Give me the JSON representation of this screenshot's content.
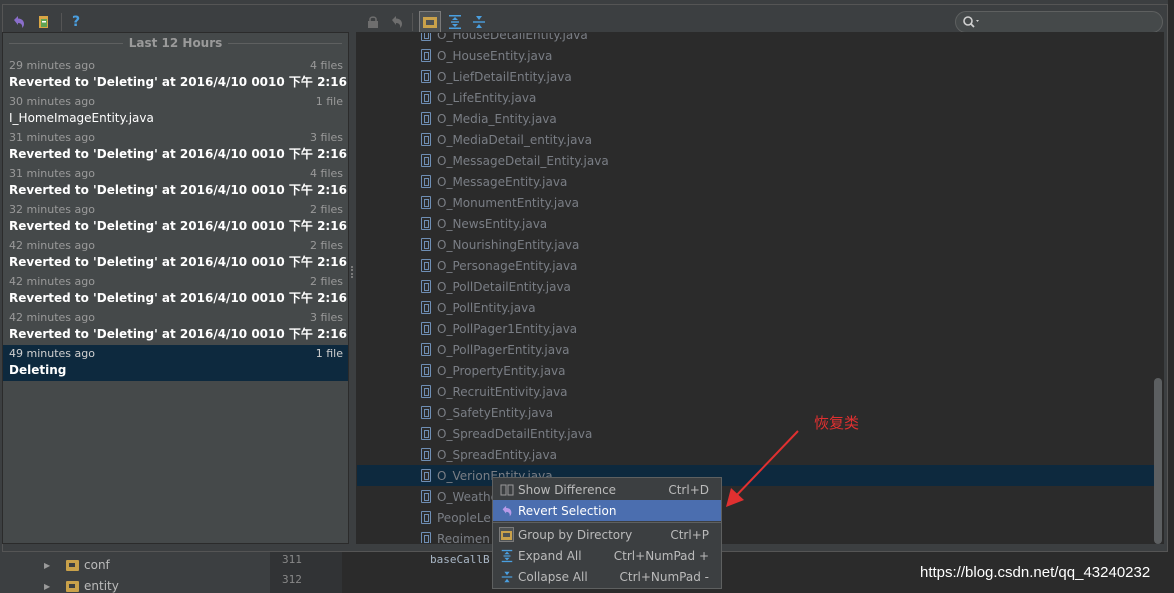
{
  "background": {
    "tree_items": [
      {
        "label": "conf"
      },
      {
        "label": "entity"
      }
    ],
    "line_numbers": [
      "311",
      "312"
    ],
    "code_line": "baseCallB                          ntity) netTask.getResult();",
    "watermark": "https://blog.csdn.net/qq_43240232"
  },
  "toolbar": {
    "search_placeholder": ""
  },
  "history": {
    "group_header": "Last 12 Hours",
    "items": [
      {
        "time": "29 minutes ago",
        "files": "4 files",
        "title": "Reverted to 'Deleting' at 2016/4/10 0010 下午 2:16",
        "bold": true,
        "selected": false
      },
      {
        "time": "30 minutes ago",
        "files": "1 file",
        "title": "I_HomeImageEntity.java",
        "bold": false,
        "selected": false
      },
      {
        "time": "31 minutes ago",
        "files": "3 files",
        "title": "Reverted to 'Deleting' at 2016/4/10 0010 下午 2:16",
        "bold": true,
        "selected": false
      },
      {
        "time": "31 minutes ago",
        "files": "4 files",
        "title": "Reverted to 'Deleting' at 2016/4/10 0010 下午 2:16",
        "bold": true,
        "selected": false
      },
      {
        "time": "32 minutes ago",
        "files": "2 files",
        "title": "Reverted to 'Deleting' at 2016/4/10 0010 下午 2:16",
        "bold": true,
        "selected": false
      },
      {
        "time": "42 minutes ago",
        "files": "2 files",
        "title": "Reverted to 'Deleting' at 2016/4/10 0010 下午 2:16",
        "bold": true,
        "selected": false
      },
      {
        "time": "42 minutes ago",
        "files": "2 files",
        "title": "Reverted to 'Deleting' at 2016/4/10 0010 下午 2:16",
        "bold": true,
        "selected": false
      },
      {
        "time": "42 minutes ago",
        "files": "3 files",
        "title": "Reverted to 'Deleting' at 2016/4/10 0010 下午 2:16",
        "bold": true,
        "selected": false
      },
      {
        "time": "49 minutes ago",
        "files": "1 file",
        "title": "Deleting",
        "bold": true,
        "selected": true
      }
    ]
  },
  "files": [
    {
      "name": "O_HouseDetailEntity.java",
      "selected": false
    },
    {
      "name": "O_HouseEntity.java",
      "selected": false
    },
    {
      "name": "O_LiefDetailEntity.java",
      "selected": false
    },
    {
      "name": "O_LifeEntity.java",
      "selected": false
    },
    {
      "name": "O_Media_Entity.java",
      "selected": false
    },
    {
      "name": "O_MediaDetail_entity.java",
      "selected": false
    },
    {
      "name": "O_MessageDetail_Entity.java",
      "selected": false
    },
    {
      "name": "O_MessageEntity.java",
      "selected": false
    },
    {
      "name": "O_MonumentEntity.java",
      "selected": false
    },
    {
      "name": "O_NewsEntity.java",
      "selected": false
    },
    {
      "name": "O_NourishingEntity.java",
      "selected": false
    },
    {
      "name": "O_PersonageEntity.java",
      "selected": false
    },
    {
      "name": "O_PollDetailEntity.java",
      "selected": false
    },
    {
      "name": "O_PollEntity.java",
      "selected": false
    },
    {
      "name": "O_PollPager1Entity.java",
      "selected": false
    },
    {
      "name": "O_PollPagerEntity.java",
      "selected": false
    },
    {
      "name": "O_PropertyEntity.java",
      "selected": false
    },
    {
      "name": "O_RecruitEntivity.java",
      "selected": false
    },
    {
      "name": "O_SafetyEntity.java",
      "selected": false
    },
    {
      "name": "O_SpreadDetailEntity.java",
      "selected": false
    },
    {
      "name": "O_SpreadEntity.java",
      "selected": false
    },
    {
      "name": "O_VerionEntity.java",
      "selected": true
    },
    {
      "name": "O_WeatherEntity.java",
      "selected": false
    },
    {
      "name": "PeopleLe",
      "selected": false
    },
    {
      "name": "Regimen",
      "selected": false
    }
  ],
  "context_menu": {
    "items": [
      {
        "label": "Show Difference",
        "shortcut": "Ctrl+D",
        "icon": "diff-icon",
        "selected": false
      },
      {
        "label": "Revert Selection",
        "shortcut": "",
        "icon": "revert-icon",
        "selected": true
      },
      {
        "label": "Group by Directory",
        "shortcut": "Ctrl+P",
        "icon": "folder-icon",
        "selected": false
      },
      {
        "label": "Expand All",
        "shortcut": "Ctrl+NumPad +",
        "icon": "expand-all-icon",
        "selected": false
      },
      {
        "label": "Collapse All",
        "shortcut": "Ctrl+NumPad -",
        "icon": "collapse-all-icon",
        "selected": false
      }
    ]
  },
  "annotation": {
    "text": "恢复类",
    "color": "#e03030"
  },
  "colors": {
    "selection": "#0d293e",
    "menu_highlight": "#4b6eaf"
  }
}
